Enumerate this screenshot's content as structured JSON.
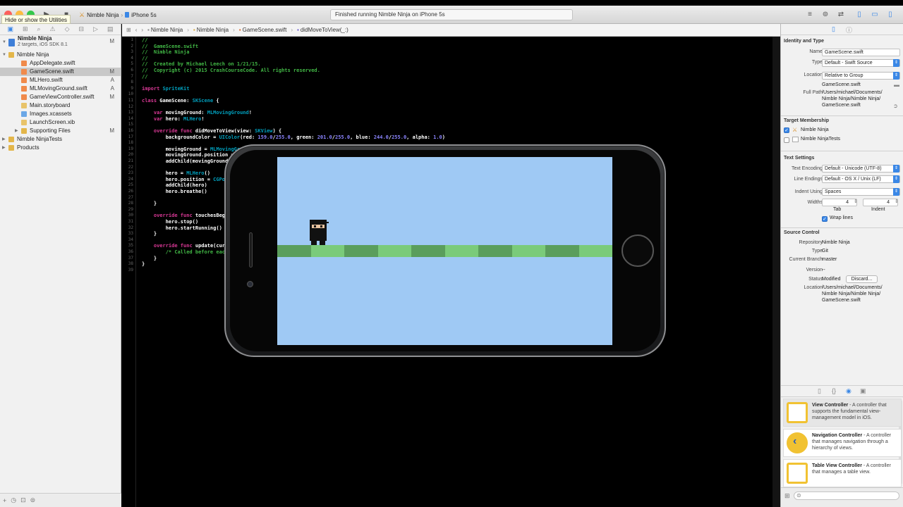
{
  "toolbar": {
    "scheme_target": "Nimble Ninja",
    "scheme_device": "iPhone 5s",
    "status": "Finished running Nimble Ninja on iPhone 5s",
    "tooltip": "Hide or show the Utilities"
  },
  "navigator": {
    "project": {
      "name": "Nimble Ninja",
      "subtitle": "2 targets, iOS SDK 8.1",
      "status": "M"
    },
    "items": [
      {
        "label": "Nimble Ninja",
        "type": "folder",
        "level": 1,
        "status": ""
      },
      {
        "label": "AppDelegate.swift",
        "type": "file",
        "level": 2,
        "status": ""
      },
      {
        "label": "GameScene.swift",
        "type": "file",
        "level": 2,
        "status": "M",
        "selected": true
      },
      {
        "label": "MLHero.swift",
        "type": "file",
        "level": 2,
        "status": "A"
      },
      {
        "label": "MLMovingGround.swift",
        "type": "file",
        "level": 2,
        "status": "A"
      },
      {
        "label": "GameViewController.swift",
        "type": "file",
        "level": 2,
        "status": "M"
      },
      {
        "label": "Main.storyboard",
        "type": "file",
        "level": 2,
        "status": ""
      },
      {
        "label": "Images.xcassets",
        "type": "file",
        "level": 2,
        "status": ""
      },
      {
        "label": "LaunchScreen.xib",
        "type": "file",
        "level": 2,
        "status": ""
      },
      {
        "label": "Supporting Files",
        "type": "folder",
        "level": 2,
        "status": "M"
      },
      {
        "label": "Nimble NinjaTests",
        "type": "folder",
        "level": 1,
        "status": ""
      },
      {
        "label": "Products",
        "type": "folder",
        "level": 1,
        "status": ""
      }
    ]
  },
  "jumpbar": [
    "Nimble Ninja",
    "Nimble Ninja",
    "GameScene.swift",
    "didMoveToView(_:)"
  ],
  "code": [
    "//",
    "//  GameScene.swift",
    "//  Nimble Ninja",
    "//",
    "//  Created by Michael Leech on 1/21/15.",
    "//  Copyright (c) 2015 CrashCourseCode. All rights reserved.",
    "//",
    "",
    "import SpriteKit",
    "",
    "class GameScene: SKScene {",
    "",
    "    var movingGround: MLMovingGround!",
    "    var hero: MLHero!",
    "",
    "    override func didMoveToView(view: SKView) {",
    "        backgroundColor = UIColor(red: 159.0/255.0, green: 201.0/255.0, blue: 244.0/255.0, alpha: 1.0)",
    "",
    "        movingGround = MLMovingGround(size: CGSizeMake(view.frame.width, 20))",
    "        movingGround.position = CGPointMake(0, view.frame.size.height/2)",
    "        addChild(movingGround)",
    "",
    "        hero = MLHero()",
    "        hero.position = CGPointMake(70, movingGround.position.y + movingGround.frame.size.height/2 + hero.frame.size.height/2)",
    "        addChild(hero)",
    "        hero.breathe()",
    "",
    "    }",
    "",
    "    override func touchesBegan(touches: NSSet, withEvent event: UIEvent) {",
    "        hero.stop()",
    "        hero.startRunning()",
    "    }",
    "",
    "    override func update(currentTime: CFTimeInterval) {",
    "        /* Called before each frame is rendered */",
    "    }",
    "}",
    ""
  ],
  "utilities": {
    "identity": {
      "title": "Identity and Type",
      "name_label": "Name",
      "name": "GameScene.swift",
      "type_label": "Type",
      "type": "Default - Swift Source",
      "location_label": "Location",
      "location": "Relative to Group",
      "location_file": "GameScene.swift",
      "fullpath_label": "Full Path",
      "fullpath": [
        "/Users/michael/Documents/",
        "Nimble Ninja/Nimble Ninja/",
        "GameScene.swift"
      ]
    },
    "target": {
      "title": "Target Membership",
      "items": [
        {
          "label": "Nimble Ninja",
          "checked": true
        },
        {
          "label": "Nimble NinjaTests",
          "checked": false
        }
      ]
    },
    "text_settings": {
      "title": "Text Settings",
      "encoding_label": "Text Encoding",
      "encoding": "Default - Unicode (UTF-8)",
      "endings_label": "Line Endings",
      "endings": "Default - OS X / Unix (LF)",
      "indent_label": "Indent Using",
      "indent": "Spaces",
      "widths_label": "Widths",
      "tab_width": "4",
      "indent_width": "4",
      "tab_label": "Tab",
      "indent_sub_label": "Indent",
      "wrap_label": "Wrap lines"
    },
    "source_control": {
      "title": "Source Control",
      "repo_label": "Repository",
      "repo": "Nimble Ninja",
      "type_label": "Type",
      "type": "Git",
      "branch_label": "Current Branch",
      "branch": "master",
      "version_label": "Version",
      "version": "--",
      "status_label": "Status",
      "status": "Modified",
      "discard": "Discard...",
      "location_label": "Location",
      "location": [
        "/Users/michael/Documents/",
        "Nimble Ninja/Nimble Ninja/",
        "GameScene.swift"
      ]
    },
    "library": [
      {
        "title": "View Controller",
        "desc": " - A controller that supports the fundamental view-management model in iOS.",
        "icon": "view-controller-icon"
      },
      {
        "title": "Navigation Controller",
        "desc": " - A controller that manages navigation through a hierarchy of views.",
        "icon": "navigation-controller-icon"
      },
      {
        "title": "Table View Controller",
        "desc": " - A controller that manages a table view.",
        "icon": "table-view-controller-icon"
      }
    ]
  },
  "simulator": {
    "background_color": "#9fc9f4",
    "ground_colors": [
      "#5a9e5c",
      "#7acb7a"
    ]
  }
}
